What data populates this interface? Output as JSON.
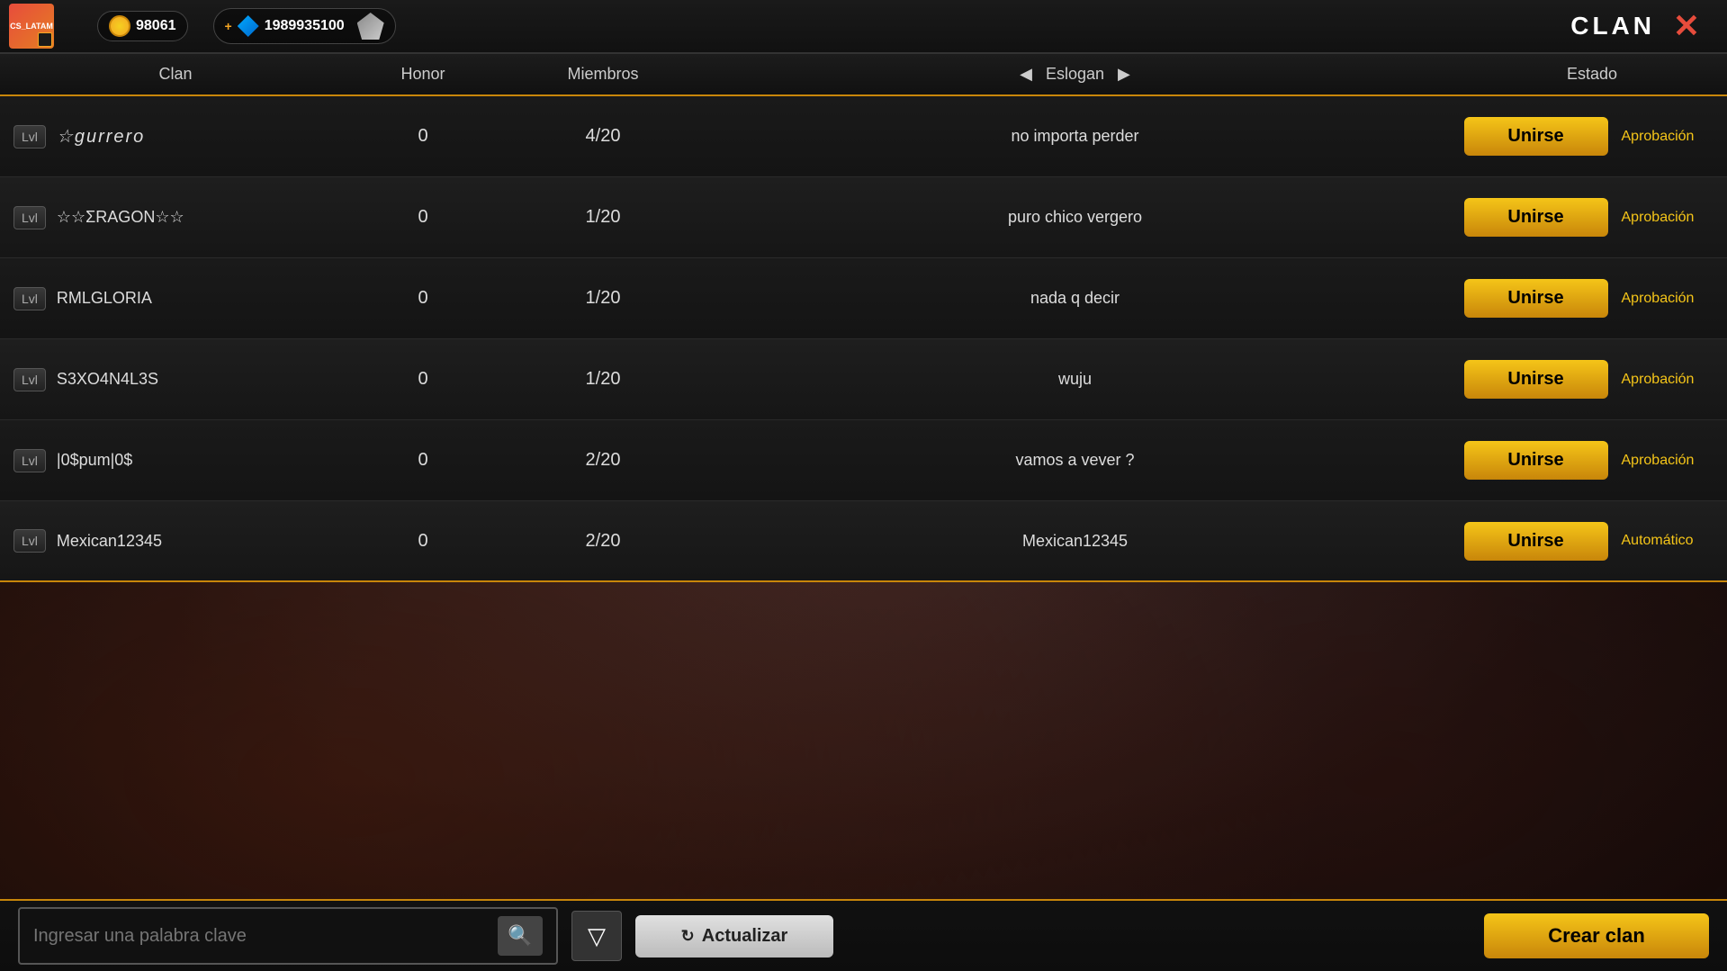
{
  "header": {
    "server": "CS_LATAM",
    "coins": "98061",
    "diamond_plus": "+",
    "diamonds": "1989935100",
    "title": "CLAN",
    "close_label": "✕"
  },
  "table": {
    "columns": {
      "clan": "Clan",
      "honor": "Honor",
      "members": "Miembros",
      "slogan": "Eslogan",
      "estado": "Estado"
    },
    "rows": [
      {
        "lvl": "Lvl",
        "name": "☆gurrero",
        "honor": "0",
        "members": "4/20",
        "slogan": "no importa perder",
        "btn": "Unirse",
        "estado": "Aprobación"
      },
      {
        "lvl": "Lvl",
        "name": "☆☆ΣRAGON☆☆",
        "honor": "0",
        "members": "1/20",
        "slogan": "puro chico vergero",
        "btn": "Unirse",
        "estado": "Aprobación"
      },
      {
        "lvl": "Lvl",
        "name": "RMLGLORIA",
        "honor": "0",
        "members": "1/20",
        "slogan": "nada q decir",
        "btn": "Unirse",
        "estado": "Aprobación"
      },
      {
        "lvl": "Lvl",
        "name": "S3XO4N4L3S",
        "honor": "0",
        "members": "1/20",
        "slogan": "wuju",
        "btn": "Unirse",
        "estado": "Aprobación"
      },
      {
        "lvl": "Lvl",
        "name": "|0$pum|0$",
        "honor": "0",
        "members": "2/20",
        "slogan": "vamos a vever ?",
        "btn": "Unirse",
        "estado": "Aprobación"
      },
      {
        "lvl": "Lvl",
        "name": "Mexican12345",
        "honor": "0",
        "members": "2/20",
        "slogan": "Mexican12345",
        "btn": "Unirse",
        "estado": "Automático"
      }
    ]
  },
  "bottom": {
    "search_placeholder": "Ingresar una palabra clave",
    "filter_icon": "▽",
    "actualizar": "Actualizar",
    "crear": "Crear clan"
  }
}
